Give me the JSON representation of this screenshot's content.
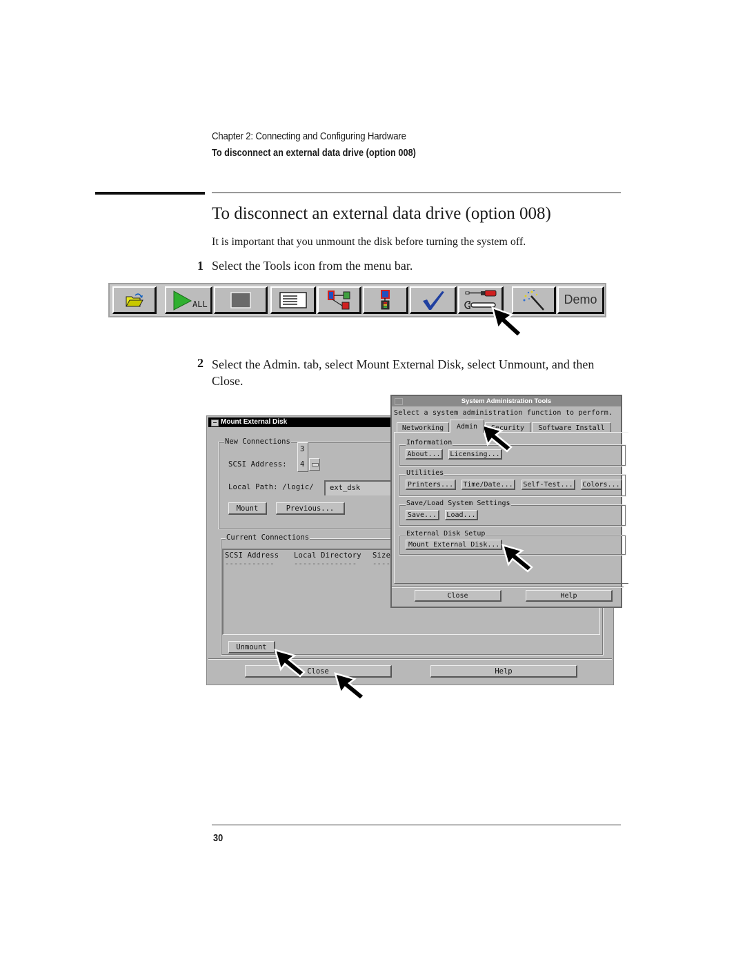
{
  "header": {
    "chapter": "Chapter 2: Connecting and Configuring Hardware",
    "section": "To disconnect an external data drive (option 008)"
  },
  "title": "To disconnect an external data drive (option 008)",
  "intro": "It is important that you unmount the disk before turning the system off.",
  "steps": [
    {
      "number": "1",
      "text": "Select the Tools icon from the menu bar."
    },
    {
      "number": "2",
      "text": "Select the Admin. tab, select Mount External Disk, select Unmount, and then Close."
    }
  ],
  "toolbar": {
    "buttons": [
      {
        "icon": "open-folder-icon"
      },
      {
        "icon": "run-all-icon",
        "label": "ALL"
      },
      {
        "icon": "stop-icon"
      },
      {
        "icon": "listing-icon"
      },
      {
        "icon": "system-config-icon"
      },
      {
        "icon": "module-icon"
      },
      {
        "icon": "checkmark-icon"
      },
      {
        "icon": "tools-icon"
      },
      {
        "icon": "magic-wand-icon"
      },
      {
        "icon": "demo-icon",
        "label": "Demo"
      }
    ]
  },
  "mount_dialog": {
    "title": "Mount External Disk",
    "new_connections_label": "New Connections",
    "scsi_address_label": "SCSI Address:",
    "scsi_address_options": [
      "3",
      "4"
    ],
    "scsi_address_value": "4",
    "local_path_label": "Local Path: /logic/",
    "local_path_value": "ext_dsk",
    "mount_label": "Mount",
    "previous_label": "Previous...",
    "current_connections_label": "Current Connections",
    "columns": [
      "SCSI Address",
      "Local Directory",
      "Size"
    ],
    "dashes": [
      "-----------",
      "--------------",
      "----"
    ],
    "unmount_label": "Unmount",
    "close_label": "Close",
    "help_label": "Help"
  },
  "sysadmin_dialog": {
    "title": "System Administration Tools",
    "prompt": "Select a system administration function to perform.",
    "tabs": [
      "Networking",
      "Admin",
      "Security",
      "Software Install"
    ],
    "active_tab": "Admin",
    "groups": {
      "information": {
        "label": "Information",
        "buttons": [
          "About...",
          "Licensing..."
        ]
      },
      "utilities": {
        "label": "Utilities",
        "buttons": [
          "Printers...",
          "Time/Date...",
          "Self-Test...",
          "Colors..."
        ]
      },
      "saveload": {
        "label": "Save/Load System Settings",
        "buttons": [
          "Save...",
          "Load..."
        ]
      },
      "external": {
        "label": "External Disk Setup",
        "buttons": [
          "Mount External Disk..."
        ]
      }
    },
    "close_label": "Close",
    "help_label": "Help"
  },
  "page_number": "30"
}
